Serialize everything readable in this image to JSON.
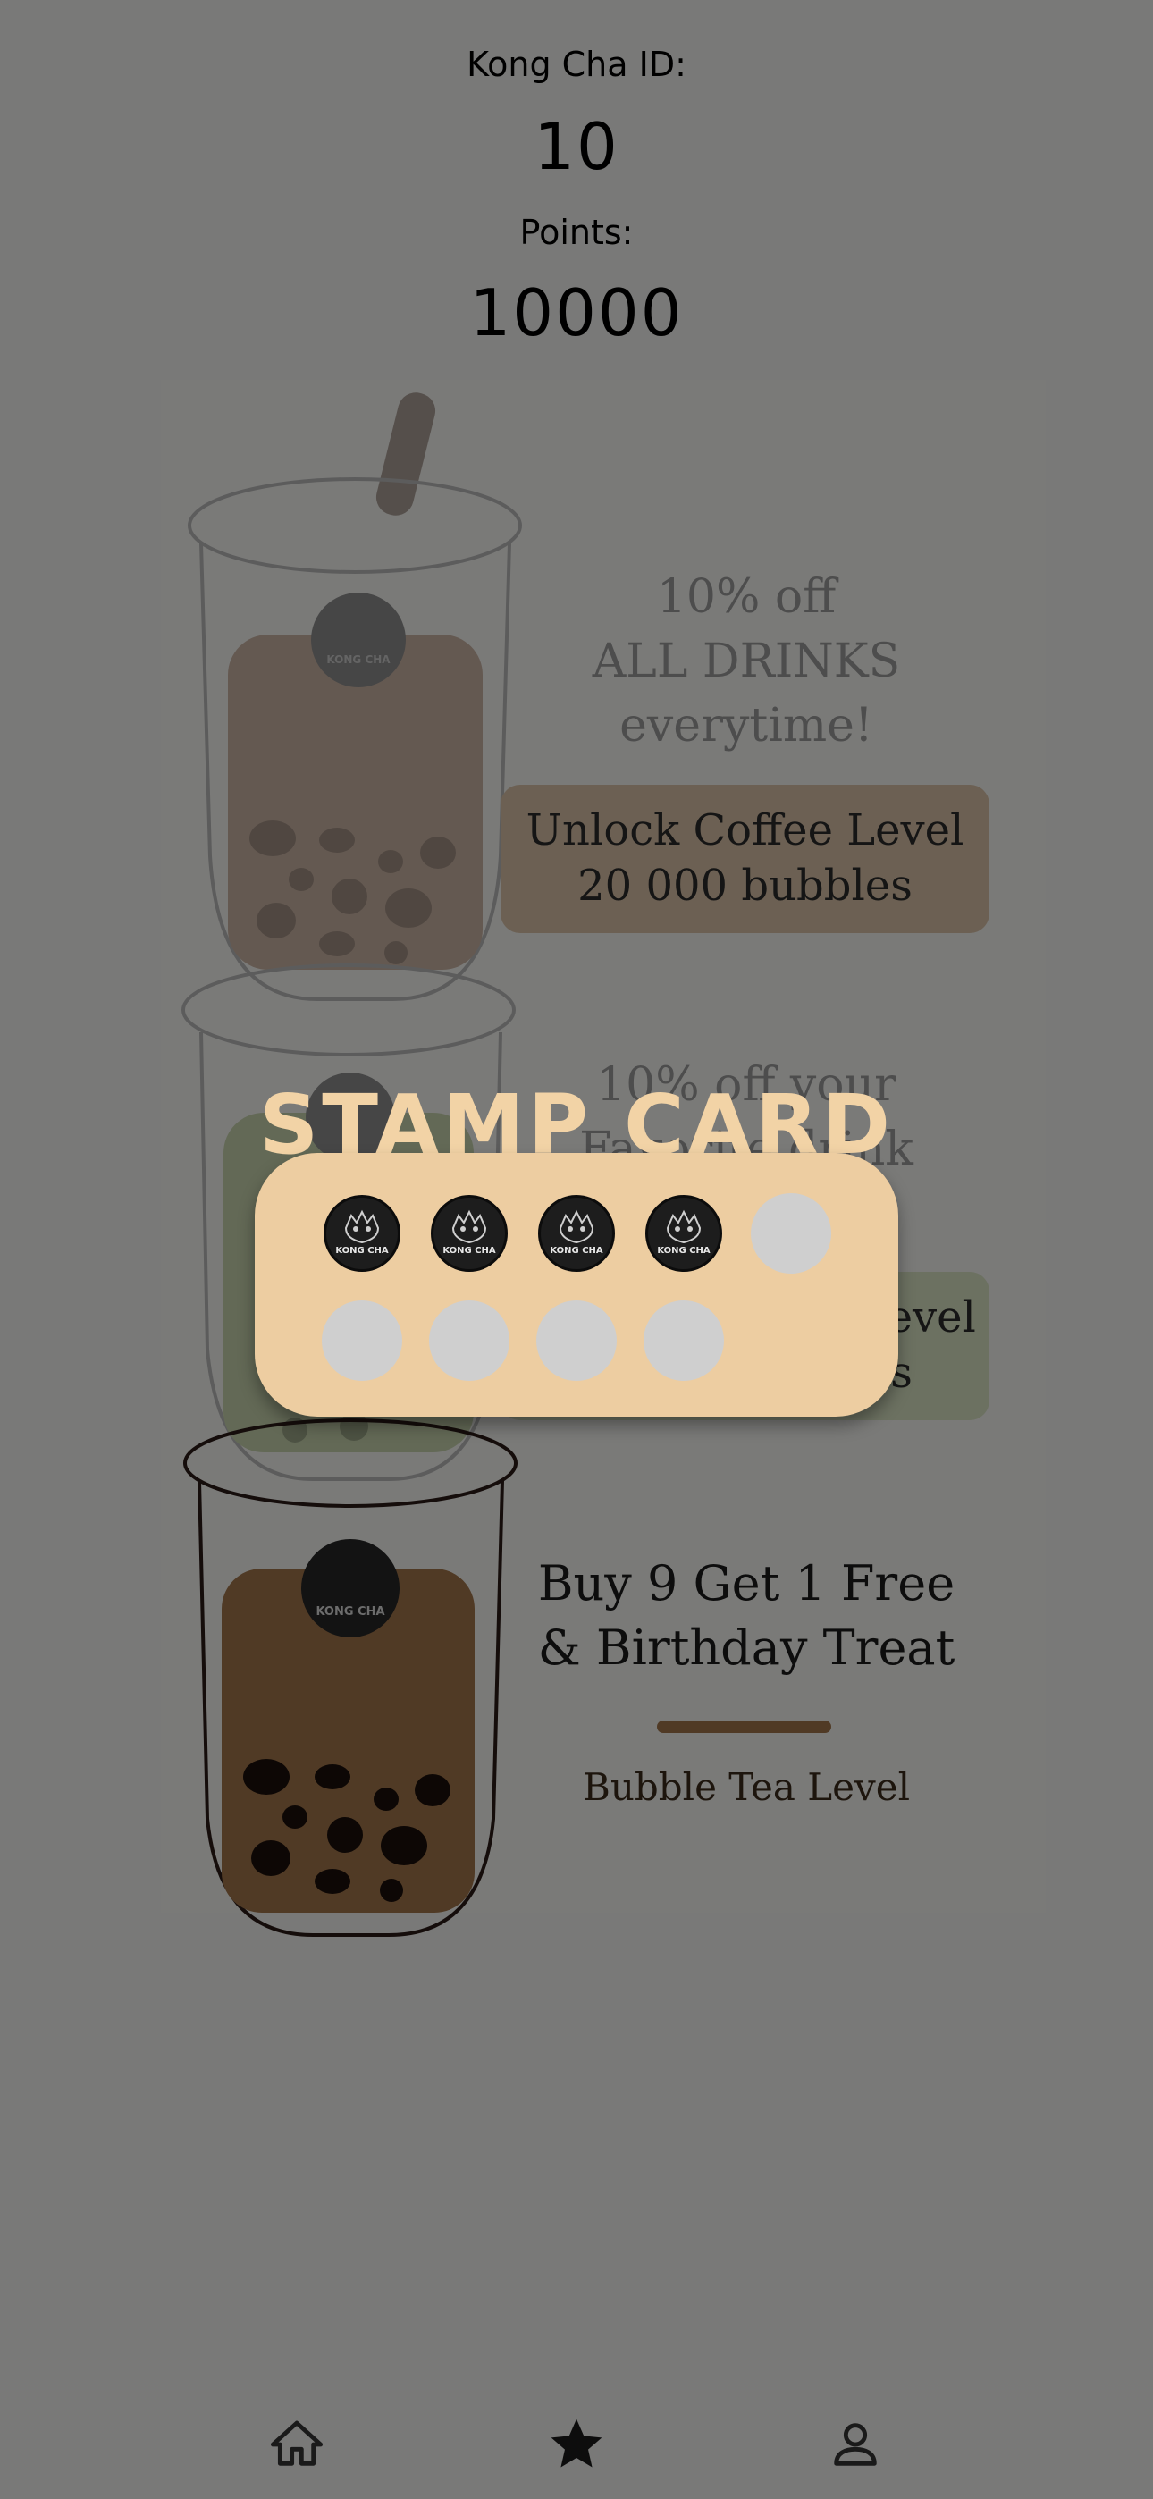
{
  "header": {
    "id_label": "Kong Cha ID:",
    "id_value": "10",
    "points_label": "Points:",
    "points_value": "10000"
  },
  "tiers": [
    {
      "name": "coffee",
      "perk_lines": [
        "10% off",
        "ALL DRINKS",
        "everytime!"
      ],
      "unlock_lines": [
        "Unlock Coffee Level",
        "20 000 bubbles"
      ]
    },
    {
      "name": "matcha",
      "perk_lines": [
        "10% off your",
        "Favorite drink"
      ],
      "unlock_lines": [
        "Unlock Matcha Level",
        "10 000 bubbles"
      ]
    },
    {
      "name": "bubble-tea",
      "perk_lines": [
        "Buy 9 Get 1 Free",
        "& Birthday Treat"
      ],
      "level_label": "Bubble Tea Level"
    }
  ],
  "cup_logo_text": "KONG CHA",
  "stamp_card": {
    "title": "STAMP CARD",
    "total": 9,
    "collected": 4,
    "stamp_logo_text": "KONG CHA"
  },
  "nav": {
    "items": [
      {
        "icon": "home-icon",
        "active": false
      },
      {
        "icon": "star-icon",
        "active": true
      },
      {
        "icon": "person-icon",
        "active": false
      }
    ]
  },
  "colors": {
    "stamp_card_bg": "#edcda1",
    "stamp_title": "#f2d3a6",
    "coffee_box": "#d8c1a6",
    "matcha_box": "#d9e2c2",
    "tea_brown": "#a0744a",
    "overlay": "rgba(0,0,0,0.5)"
  }
}
